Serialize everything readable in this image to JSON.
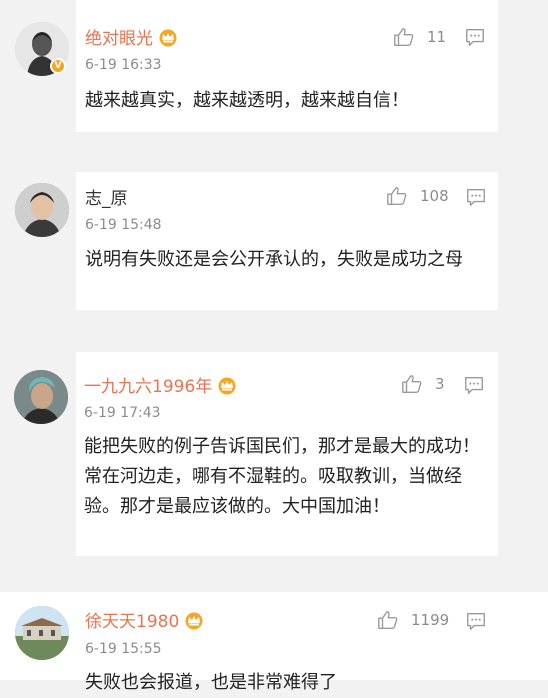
{
  "comments": [
    {
      "username": "绝对眼光",
      "vip": true,
      "verified": true,
      "time": "6-19 16:33",
      "likes": "11",
      "content": "越来越真实，越来越透明，越来越自信！"
    },
    {
      "username": "志_原",
      "vip": false,
      "verified": false,
      "time": "6-19 15:48",
      "likes": "108",
      "content": "说明有失败还是会公开承认的，失败是成功之母"
    },
    {
      "username": "一九九六1996年",
      "vip": true,
      "verified": false,
      "time": "6-19 17:43",
      "likes": "3",
      "content": "能把失败的例子告诉国民们，那才是最大的成功！常在河边走，哪有不湿鞋的。吸取教训，当做经验。那才是最应该做的。大中国加油！"
    },
    {
      "username": "徐天天1980",
      "vip": true,
      "verified": false,
      "time": "6-19 15:55",
      "likes": "1199",
      "content": "失败也会报道，也是非常难得了"
    }
  ],
  "icons": {
    "like": "thumbs-up-icon",
    "comment": "comment-icon",
    "vip": "crown-icon",
    "verified": "verified-v-icon"
  },
  "colors": {
    "vip_name": "#eb7350",
    "time": "#8c8c8c",
    "icon": "#9a9a9a",
    "crown": "#f5a623"
  }
}
